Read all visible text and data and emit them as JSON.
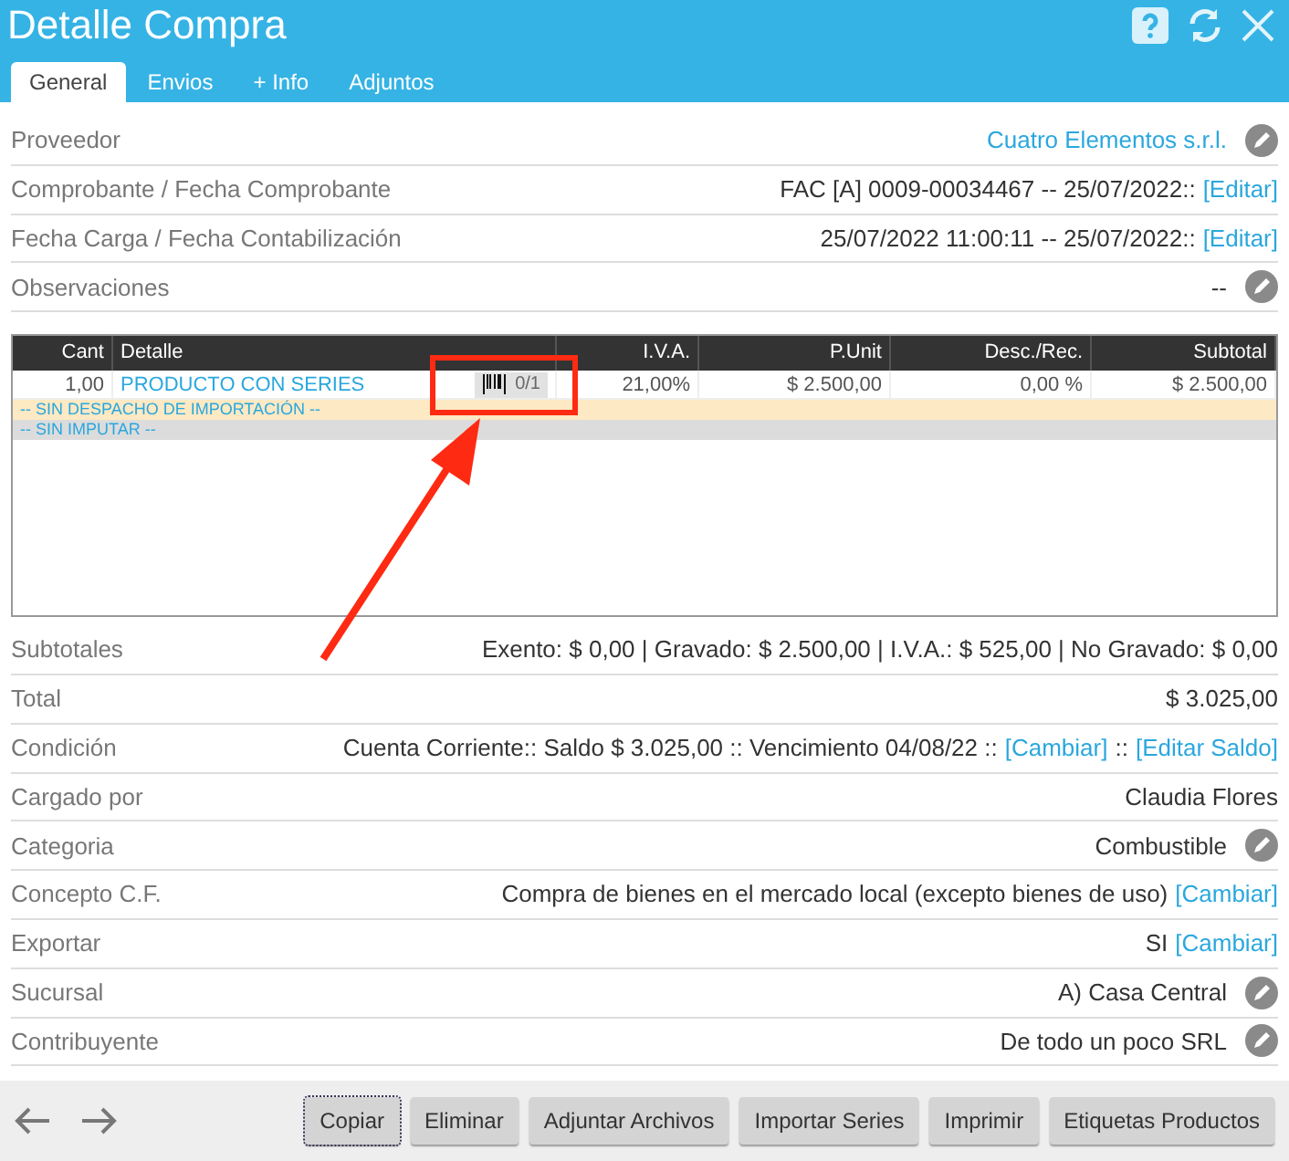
{
  "window": {
    "title": "Detalle Compra"
  },
  "tabs": [
    {
      "label": "General",
      "selected": true
    },
    {
      "label": "Envios",
      "selected": false
    },
    {
      "label": "+ Info",
      "selected": false
    },
    {
      "label": "Adjuntos",
      "selected": false
    }
  ],
  "fields_top": [
    {
      "label": "Proveedor",
      "value": [
        {
          "kind": "link",
          "text": "Cuatro Elementos s.r.l."
        }
      ],
      "editable": true
    },
    {
      "label": "Comprobante / Fecha Comprobante",
      "value": [
        {
          "kind": "text",
          "text": "FAC [A] 0009-00034467 -- 25/07/2022::"
        },
        {
          "kind": "link",
          "text": "[Editar]"
        }
      ],
      "editable": false
    },
    {
      "label": "Fecha Carga / Fecha Contabilización",
      "value": [
        {
          "kind": "text",
          "text": "25/07/2022 11:00:11 -- 25/07/2022::"
        },
        {
          "kind": "link",
          "text": "[Editar]"
        }
      ],
      "editable": false
    },
    {
      "label": "Observaciones",
      "value": [
        {
          "kind": "text",
          "text": "--"
        }
      ],
      "editable": true
    }
  ],
  "table": {
    "columns": [
      "Cant",
      "Detalle",
      "I.V.A.",
      "P.Unit",
      "Desc./Rec.",
      "Subtotal"
    ],
    "rows": [
      {
        "cant": "1,00",
        "detalle": "PRODUCTO CON SERIES",
        "series": "0/1",
        "iva": "21,00%",
        "punit": "$ 2.500,00",
        "desc": "0,00 %",
        "subtotal": "$ 2.500,00"
      }
    ],
    "notes": [
      {
        "text": "-- SIN DESPACHO DE IMPORTACIÓN --",
        "color": "#fde9c3"
      },
      {
        "text": "-- SIN IMPUTAR --",
        "color": "#dcdcdc"
      }
    ]
  },
  "fields_bottom": [
    {
      "label": "Subtotales",
      "value": [
        {
          "kind": "text",
          "text": "Exento: $ 0,00 | Gravado: $ 2.500,00 | I.V.A.: $ 525,00 | No Gravado: $ 0,00"
        }
      ],
      "editable": false
    },
    {
      "label": "Total",
      "value": [
        {
          "kind": "text",
          "text": "$ 3.025,00"
        }
      ],
      "editable": false
    },
    {
      "label": "Condición",
      "value": [
        {
          "kind": "text",
          "text": "Cuenta Corriente:: Saldo $ 3.025,00 :: Vencimiento 04/08/22 ::"
        },
        {
          "kind": "link",
          "text": "[Cambiar]"
        },
        {
          "kind": "text",
          "text": "::"
        },
        {
          "kind": "link",
          "text": "[Editar Saldo]"
        }
      ],
      "editable": false
    },
    {
      "label": "Cargado por",
      "value": [
        {
          "kind": "text",
          "text": "Claudia Flores"
        }
      ],
      "editable": false
    },
    {
      "label": "Categoria",
      "value": [
        {
          "kind": "text",
          "text": "Combustible"
        }
      ],
      "editable": true
    },
    {
      "label": "Concepto C.F.",
      "value": [
        {
          "kind": "text",
          "text": "Compra de bienes en el mercado local (excepto bienes de uso)"
        },
        {
          "kind": "link",
          "text": "[Cambiar]"
        }
      ],
      "editable": false
    },
    {
      "label": "Exportar",
      "value": [
        {
          "kind": "text",
          "text": "SI"
        },
        {
          "kind": "link",
          "text": "[Cambiar]"
        }
      ],
      "editable": false
    },
    {
      "label": "Sucursal",
      "value": [
        {
          "kind": "text",
          "text": "A) Casa Central"
        }
      ],
      "editable": true
    },
    {
      "label": "Contribuyente",
      "value": [
        {
          "kind": "text",
          "text": "De todo un poco SRL"
        }
      ],
      "editable": true
    }
  ],
  "buttons": [
    {
      "label": "Copiar",
      "focused": true
    },
    {
      "label": "Eliminar",
      "focused": false
    },
    {
      "label": "Adjuntar Archivos",
      "focused": false
    },
    {
      "label": "Importar Series",
      "focused": false
    },
    {
      "label": "Imprimir",
      "focused": false
    },
    {
      "label": "Etiquetas Productos",
      "focused": false
    }
  ]
}
